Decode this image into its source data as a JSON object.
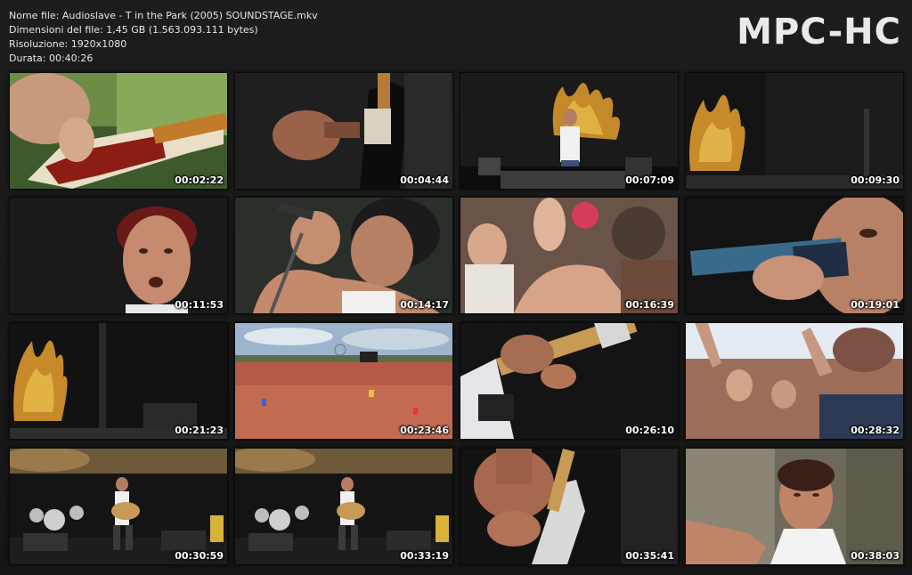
{
  "file_info": {
    "name_line": "Nome file: Audioslave - T in the Park (2005) SOUNDSTAGE.mkv",
    "size_line": "Dimensioni del file: 1,45 GB (1.563.093.111 bytes)",
    "resolution_line": "Risoluzione: 1920x1080",
    "duration_line": "Durata: 00:40:26"
  },
  "brand": "MPC-HC",
  "thumbnails": [
    {
      "timestamp": "00:02:22",
      "scene": "bass-guitar-closeup"
    },
    {
      "timestamp": "00:04:44",
      "scene": "guitar-hand-dark"
    },
    {
      "timestamp": "00:07:09",
      "scene": "singer-on-stage-flame"
    },
    {
      "timestamp": "00:09:30",
      "scene": "flame-logo-dark-stage"
    },
    {
      "timestamp": "00:11:53",
      "scene": "singer-face-closeup"
    },
    {
      "timestamp": "00:14:17",
      "scene": "singer-with-microphone"
    },
    {
      "timestamp": "00:16:39",
      "scene": "crowd-clapping"
    },
    {
      "timestamp": "00:19:01",
      "scene": "microphone-closeup"
    },
    {
      "timestamp": "00:21:23",
      "scene": "flame-logo-stage"
    },
    {
      "timestamp": "00:23:46",
      "scene": "festival-crowd-wide"
    },
    {
      "timestamp": "00:26:10",
      "scene": "bass-fretboard"
    },
    {
      "timestamp": "00:28:32",
      "scene": "crowd-hands-up"
    },
    {
      "timestamp": "00:30:59",
      "scene": "guitarist-full-stage"
    },
    {
      "timestamp": "00:33:19",
      "scene": "guitarist-full-stage"
    },
    {
      "timestamp": "00:35:41",
      "scene": "guitar-strum-closeup"
    },
    {
      "timestamp": "00:38:03",
      "scene": "singer-arm-raised"
    }
  ]
}
